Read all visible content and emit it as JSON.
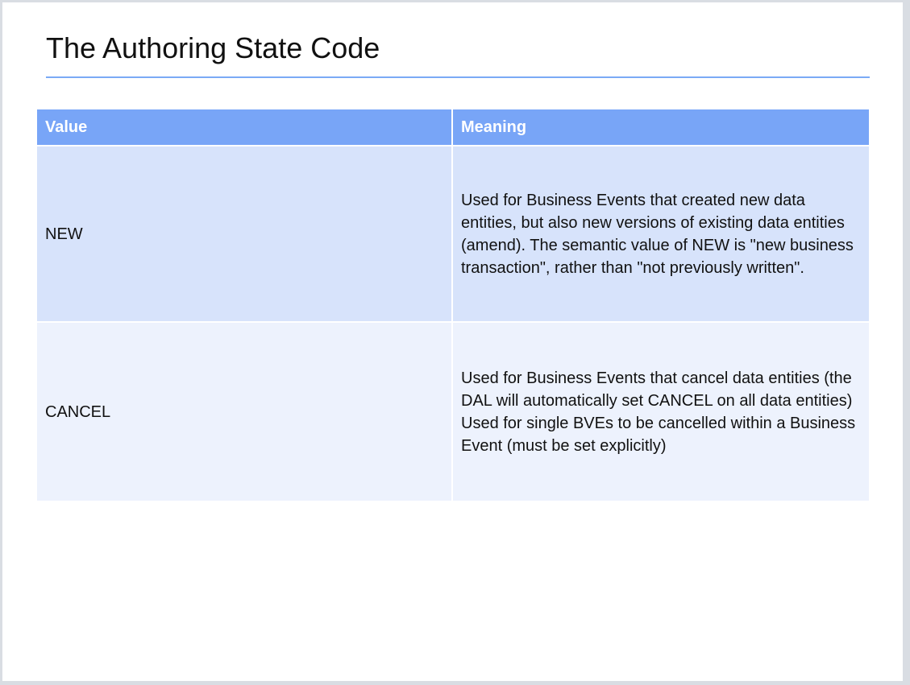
{
  "slide": {
    "title": "The Authoring State Code"
  },
  "table": {
    "headers": {
      "value": "Value",
      "meaning": "Meaning"
    },
    "rows": [
      {
        "value": "NEW",
        "meaning": [
          "Used for Business Events that created new data entities, but also new versions of existing data entities (amend). The semantic value of NEW is \"new business transaction\", rather than \"not previously written\"."
        ]
      },
      {
        "value": "CANCEL",
        "meaning": [
          "Used for Business Events that cancel data entities (the DAL will automatically set CANCEL on all data entities)",
          "Used for single BVEs to be cancelled within a Business Event (must be set explicitly)"
        ]
      }
    ]
  },
  "colors": {
    "header_bg": "#78a5f7",
    "row1_bg": "#d7e3fb",
    "row2_bg": "#edf2fd",
    "title_rule": "#7aaaf6"
  }
}
